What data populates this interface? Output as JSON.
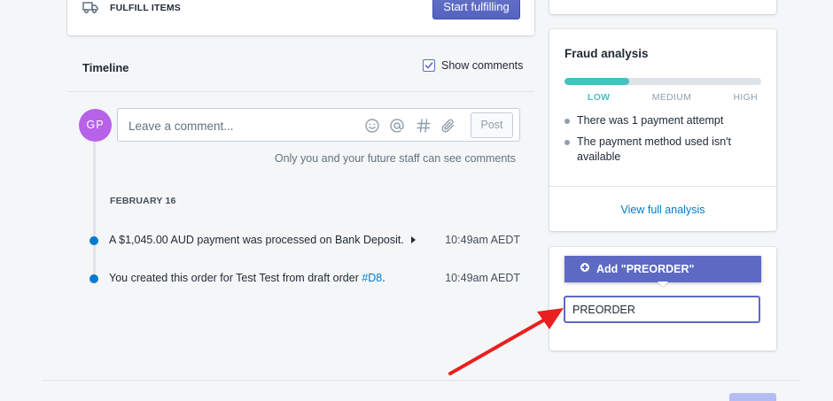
{
  "fulfill": {
    "label": "FULFILL ITEMS",
    "button_label": "Start fulfilling",
    "icon": "truck-icon"
  },
  "timeline": {
    "title": "Timeline",
    "show_comments_label": "Show comments",
    "show_comments_checked": true,
    "avatar_initials": "GP",
    "avatar_color": "#b762e8",
    "comment_placeholder": "Leave a comment...",
    "comment_icons": [
      "emoji-icon",
      "mention-icon",
      "hashtag-icon",
      "attachment-icon"
    ],
    "post_label": "Post",
    "comment_hint": "Only you and your future staff can see comments",
    "date_label": "FEBRUARY 16",
    "events": [
      {
        "text": "A $1,045.00 AUD payment was processed on Bank Deposit.",
        "time": "10:49am AEDT"
      },
      {
        "text_prefix": "You created this order for Test Test from draft order ",
        "link": "#D8",
        "text_suffix": ".",
        "time": "10:49am AEDT"
      }
    ]
  },
  "fraud": {
    "title": "Fraud analysis",
    "risk_level": "LOW",
    "risk_fraction": 0.33,
    "levels": [
      "LOW",
      "MEDIUM",
      "HIGH"
    ],
    "indicators": [
      "There was 1 payment attempt",
      "The payment method used isn't available"
    ],
    "link_label": "View full analysis",
    "accent_color": "#47c1bf"
  },
  "tags": {
    "add_option_label": "Add \"PREORDER\"",
    "input_value": "PREORDER"
  },
  "colors": {
    "primary": "#5c6ac4",
    "link": "#007ace",
    "annotation_arrow": "#e8201f"
  }
}
